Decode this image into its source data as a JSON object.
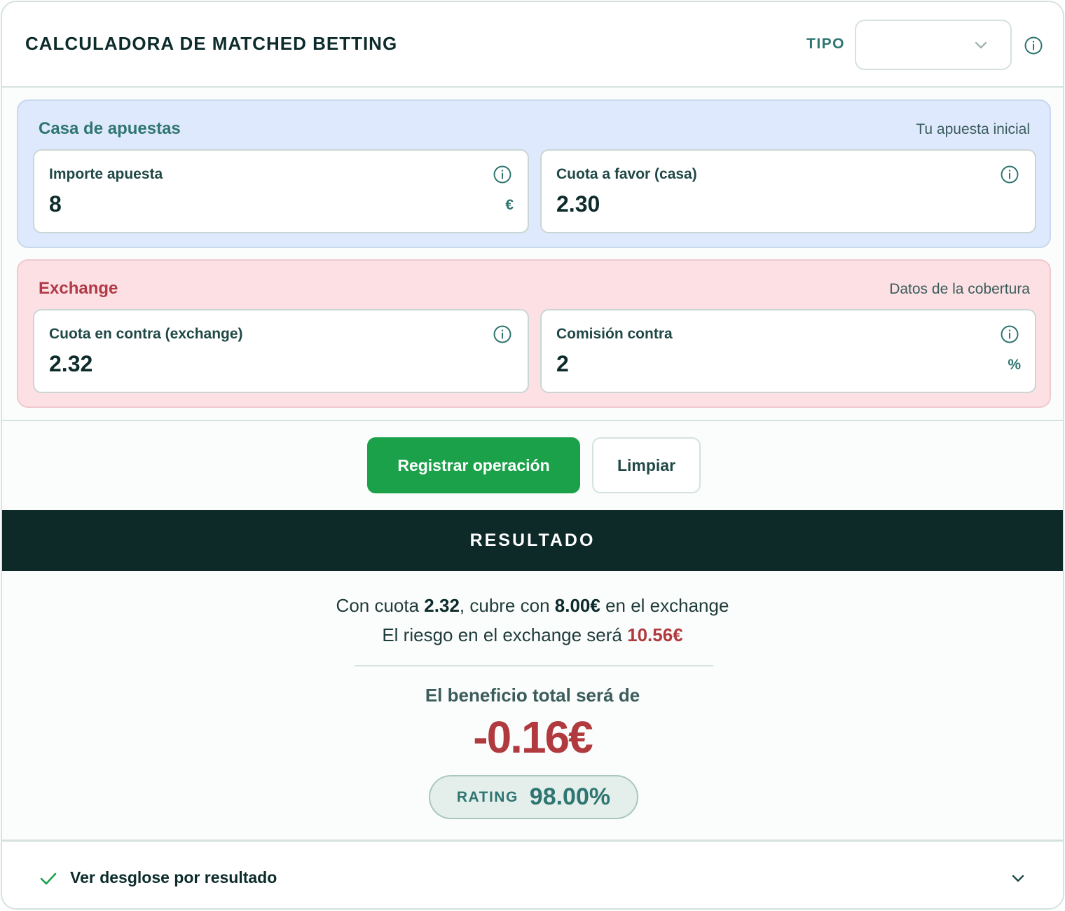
{
  "header": {
    "title": "CALCULADORA DE MATCHED BETTING",
    "tipo_label": "TIPO",
    "tipo_value": ""
  },
  "casa": {
    "title": "Casa de apuestas",
    "subtitle": "Tu apuesta inicial",
    "fields": [
      {
        "label": "Importe apuesta",
        "value": "8",
        "unit": "€"
      },
      {
        "label": "Cuota a favor (casa)",
        "value": "2.30",
        "unit": ""
      }
    ]
  },
  "exchange": {
    "title": "Exchange",
    "subtitle": "Datos de la cobertura",
    "fields": [
      {
        "label": "Cuota en contra (exchange)",
        "value": "2.32",
        "unit": ""
      },
      {
        "label": "Comisión contra",
        "value": "2",
        "unit": "%"
      }
    ]
  },
  "buttons": {
    "register": "Registrar operación",
    "clear": "Limpiar"
  },
  "result": {
    "title": "RESULTADO",
    "line1_pre": "Con cuota ",
    "lay_odds": "2.32",
    "line1_mid": ", cubre con ",
    "lay_stake": "8.00€",
    "line1_post": " en el exchange",
    "line2_pre": "El riesgo en el exchange será ",
    "liability": "10.56€",
    "profit_label": "El beneficio total será de",
    "profit_value": "-0.16€",
    "rating_label": "RATING",
    "rating_value": "98.00%"
  },
  "footer": {
    "label": "Ver desglose por resultado"
  },
  "colors": {
    "accent": "#2f7571",
    "primary_button": "#1aa14a",
    "negative": "#b03a3e",
    "casa_bg": "#dfe9fd",
    "exchange_bg": "#fde0e4",
    "result_bar": "#0d2a28"
  },
  "icons": {
    "tipo_chevron": "chevron-down-icon",
    "info": "info-icon",
    "footer_check": "check-icon",
    "footer_chevron": "chevron-down-icon"
  }
}
